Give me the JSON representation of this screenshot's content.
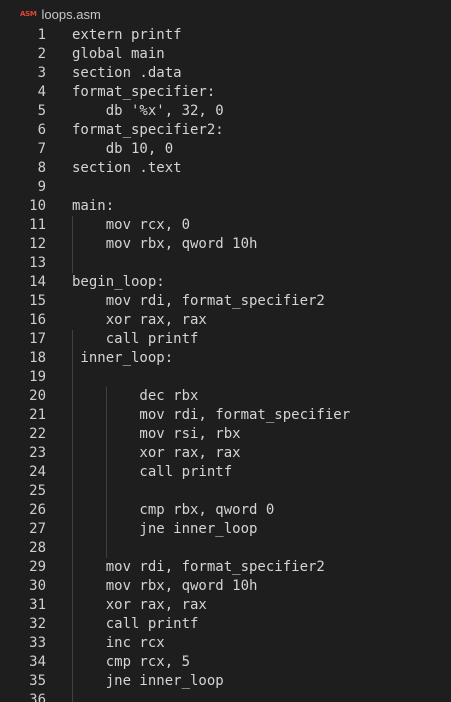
{
  "tab": {
    "icon_text": "ASM",
    "filename": "loops.asm"
  },
  "lines": [
    {
      "n": "1",
      "code": "extern printf"
    },
    {
      "n": "2",
      "code": "global main"
    },
    {
      "n": "3",
      "code": "section .data"
    },
    {
      "n": "4",
      "code": "format_specifier:"
    },
    {
      "n": "5",
      "code": "    db '%x', 32, 0"
    },
    {
      "n": "6",
      "code": "format_specifier2:"
    },
    {
      "n": "7",
      "code": "    db 10, 0"
    },
    {
      "n": "8",
      "code": "section .text"
    },
    {
      "n": "9",
      "code": ""
    },
    {
      "n": "10",
      "code": "main:"
    },
    {
      "n": "11",
      "code": "    mov rcx, 0"
    },
    {
      "n": "12",
      "code": "    mov rbx, qword 10h"
    },
    {
      "n": "13",
      "code": ""
    },
    {
      "n": "14",
      "code": "begin_loop:"
    },
    {
      "n": "15",
      "code": "    mov rdi, format_specifier2"
    },
    {
      "n": "16",
      "code": "    xor rax, rax"
    },
    {
      "n": "17",
      "code": "    call printf"
    },
    {
      "n": "18",
      "code": " inner_loop:"
    },
    {
      "n": "19",
      "code": ""
    },
    {
      "n": "20",
      "code": "        dec rbx"
    },
    {
      "n": "21",
      "code": "        mov rdi, format_specifier"
    },
    {
      "n": "22",
      "code": "        mov rsi, rbx"
    },
    {
      "n": "23",
      "code": "        xor rax, rax"
    },
    {
      "n": "24",
      "code": "        call printf"
    },
    {
      "n": "25",
      "code": ""
    },
    {
      "n": "26",
      "code": "        cmp rbx, qword 0"
    },
    {
      "n": "27",
      "code": "        jne inner_loop"
    },
    {
      "n": "28",
      "code": ""
    },
    {
      "n": "29",
      "code": "    mov rdi, format_specifier2"
    },
    {
      "n": "30",
      "code": "    mov rbx, qword 10h"
    },
    {
      "n": "31",
      "code": "    xor rax, rax"
    },
    {
      "n": "32",
      "code": "    call printf"
    },
    {
      "n": "33",
      "code": "    inc rcx"
    },
    {
      "n": "34",
      "code": "    cmp rcx, 5"
    },
    {
      "n": "35",
      "code": "    jne inner_loop"
    },
    {
      "n": "36",
      "code": ""
    }
  ]
}
